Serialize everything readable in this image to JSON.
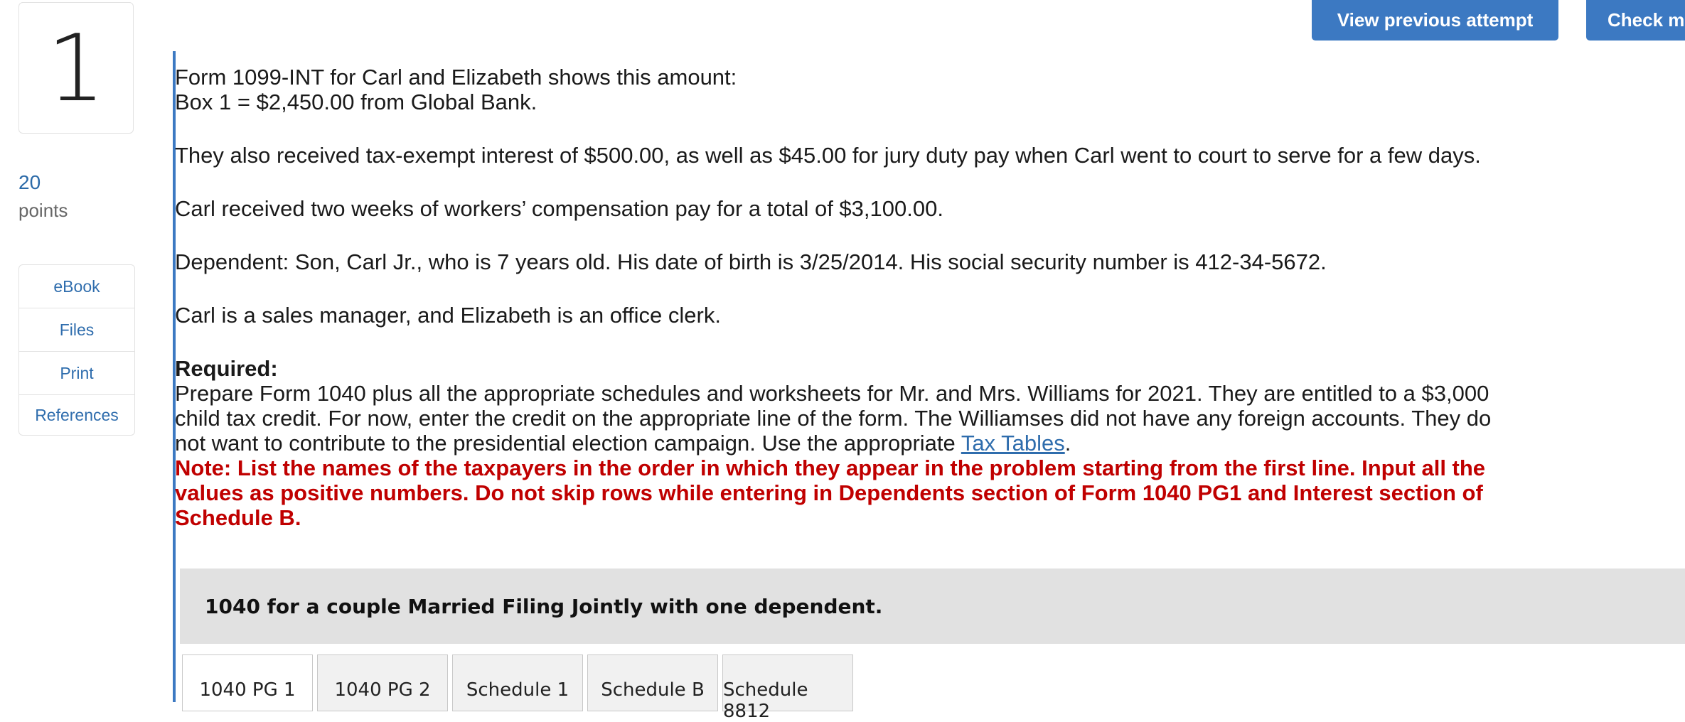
{
  "question": {
    "number": "1",
    "points_value": "20",
    "points_label": "points"
  },
  "side_menu": {
    "items": [
      "eBook",
      "Files",
      "Print",
      "References"
    ]
  },
  "top_buttons": {
    "view_previous": "View previous attempt",
    "check": "Check m"
  },
  "content": {
    "line1": "Form 1099-INT for Carl and Elizabeth shows this amount:",
    "line2": "Box 1 = $2,450.00 from Global Bank.",
    "para_interest": "They also received tax-exempt interest of $500.00, as well as $45.00 for jury duty pay when Carl went to court to serve for a few days.",
    "para_workers": "Carl received two weeks of workers’ compensation pay for a total of $3,100.00.",
    "para_dependent": "Dependent: Son, Carl Jr., who is 7 years old. His date of birth is 3/25/2014. His social security number is 412-34-5672.",
    "para_jobs": "Carl is a sales manager, and Elizabeth is an office clerk.",
    "required_label": "Required:",
    "required_text": "Prepare Form 1040 plus all the appropriate schedules and worksheets for Mr. and Mrs. Williams for 2021. They are entitled to a $3,000 child tax credit. For now, enter the credit on the appropriate line of the form. The Williamses did not have any foreign accounts. They do not want to contribute to the presidential election campaign.",
    "use_text": "Use the appropriate",
    "tax_tables_link": "Tax Tables",
    "period": ".",
    "note": "Note: List the names of the taxpayers in the order in which they appear in the problem starting from the first line. Input all the values as positive numbers. Do not skip rows while entering in Dependents section of Form 1040 PG1 and Interest section of Schedule B."
  },
  "band_title": "1040 for a couple Married Filing Jointly with one dependent.",
  "tabs": [
    "1040 PG 1",
    "1040 PG 2",
    "Schedule 1",
    "Schedule B",
    "Schedule 8812"
  ],
  "active_tab": "1040 PG 1",
  "colors": {
    "accent": "#3c79c2",
    "link": "#2f6dad",
    "note": "#c00000",
    "band": "#e1e1e1"
  }
}
